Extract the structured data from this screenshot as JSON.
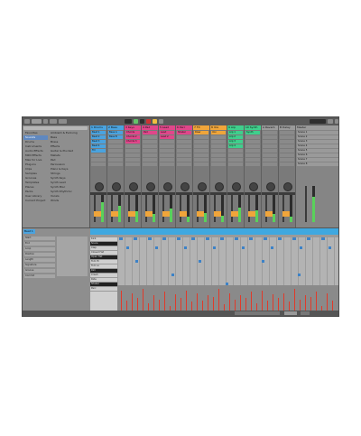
{
  "app": {
    "name": "Ableton Live"
  },
  "browser": {
    "categories": [
      "Favorites",
      "Sounds",
      "Drums",
      "Instruments",
      "Audio Effects",
      "MIDI Effects",
      "Max for Live",
      "Plug-ins",
      "Clips",
      "Samples",
      "Grooves",
      "Templates",
      "Places",
      "Packs",
      "User Library",
      "Current Project"
    ],
    "files": [
      "Ambient & Evolving",
      "Bass",
      "Brass",
      "Effects",
      "Guitar & Plucked",
      "Mallets",
      "Pad",
      "Percussion",
      "Piano & Keys",
      "Strings",
      "Synth Keys",
      "Synth Lead",
      "Synth Misc",
      "Synth Rhythmic",
      "Vocals",
      "Winds"
    ]
  },
  "tracks": [
    {
      "name": "1 Drums",
      "color": "#4aa3df",
      "clips": [
        "Beat 1",
        "Beat 2",
        "Beat 3",
        "Beat 4",
        "Fill"
      ],
      "meter": 0.75
    },
    {
      "name": "2 Bass",
      "color": "#4aa3df",
      "clips": [
        "Bass A",
        "Bass B",
        "",
        "",
        ""
      ],
      "meter": 0.6
    },
    {
      "name": "3 Keys",
      "color": "#e0468a",
      "clips": [
        "Chords",
        "Chords 2",
        "Chords 3",
        "",
        ""
      ],
      "meter": 0.4
    },
    {
      "name": "4 Pad",
      "color": "#e0468a",
      "clips": [
        "Pad",
        "",
        "",
        "",
        ""
      ],
      "meter": 0.3
    },
    {
      "name": "5 Lead",
      "color": "#e0468a",
      "clips": [
        "Lead",
        "Lead 2",
        "",
        "",
        ""
      ],
      "meter": 0.5
    },
    {
      "name": "6 Perc",
      "color": "#e0468a",
      "clips": [
        "Shaker",
        "",
        "",
        "",
        ""
      ],
      "meter": 0.2
    },
    {
      "name": "7 FX",
      "color": "#f0a53a",
      "clips": [
        "Riser",
        "",
        "",
        "",
        ""
      ],
      "meter": 0.35
    },
    {
      "name": "8 Vox",
      "color": "#f0a53a",
      "clips": [
        "Vox",
        "",
        "",
        "",
        ""
      ],
      "meter": 0.25
    },
    {
      "name": "9 Arp",
      "color": "#3fcf8c",
      "clips": [
        "Arp 1",
        "Arp 2",
        "Arp 3",
        "Arp 4",
        ""
      ],
      "meter": 0.55
    },
    {
      "name": "10 Synth",
      "color": "#3fcf8c",
      "clips": [
        "Synth",
        "",
        "",
        "",
        ""
      ],
      "meter": 0.45
    },
    {
      "name": "A Reverb",
      "color": "#9a9a9a",
      "clips": [
        "",
        "",
        "",
        "",
        ""
      ],
      "meter": 0.3
    },
    {
      "name": "B Delay",
      "color": "#9a9a9a",
      "clips": [
        "",
        "",
        "",
        "",
        ""
      ],
      "meter": 0.2
    }
  ],
  "master": {
    "name": "Master",
    "scenes": [
      "Scene 1",
      "Scene 2",
      "Scene 3",
      "Scene 4",
      "Scene 5",
      "Scene 6",
      "Scene 7",
      "Scene 8"
    ]
  },
  "clipview": {
    "clip_name": "Beat 1",
    "rows": [
      "Start",
      "End",
      "Loop",
      "Position",
      "Length",
      "Signature",
      "Groove",
      "Commit"
    ]
  },
  "editor": {
    "keys": [
      "Kick",
      "Snare",
      "Clap",
      "Closed Hat",
      "Open Hat",
      "Tom Hi",
      "Tom Lo",
      "Rim",
      "Crash",
      "Ride",
      "Shaker",
      "Perc"
    ],
    "notes": [
      [
        0,
        2,
        4
      ],
      [
        0,
        18,
        4
      ],
      [
        0,
        34,
        4
      ],
      [
        0,
        50,
        4
      ],
      [
        0,
        66,
        4
      ],
      [
        0,
        82,
        4
      ],
      [
        0,
        98,
        4
      ],
      [
        0,
        114,
        4
      ],
      [
        0,
        130,
        4
      ],
      [
        0,
        146,
        4
      ],
      [
        0,
        162,
        4
      ],
      [
        0,
        178,
        4
      ],
      [
        0,
        194,
        4
      ],
      [
        0,
        210,
        4
      ],
      [
        0,
        226,
        4
      ],
      [
        2,
        10,
        3
      ],
      [
        2,
        42,
        3
      ],
      [
        2,
        74,
        3
      ],
      [
        2,
        106,
        3
      ],
      [
        2,
        138,
        3
      ],
      [
        2,
        170,
        3
      ],
      [
        2,
        202,
        3
      ],
      [
        2,
        234,
        3
      ],
      [
        5,
        20,
        3
      ],
      [
        5,
        90,
        3
      ],
      [
        5,
        160,
        3
      ],
      [
        8,
        60,
        3
      ],
      [
        8,
        200,
        3
      ],
      [
        10,
        120,
        3
      ]
    ],
    "velocities": [
      0.9,
      0.5,
      0.8,
      0.6,
      0.95,
      0.4,
      0.7,
      0.55,
      0.85,
      0.3,
      0.75,
      0.6,
      0.9,
      0.45,
      0.8,
      0.5,
      0.7,
      0.65,
      0.95,
      0.35,
      0.8,
      0.55,
      0.7,
      0.6,
      0.85,
      0.4,
      0.9,
      0.5,
      0.75,
      0.6,
      0.8,
      0.45,
      0.95,
      0.55,
      0.7,
      0.65,
      0.85,
      0.3,
      0.8,
      0.5
    ]
  }
}
